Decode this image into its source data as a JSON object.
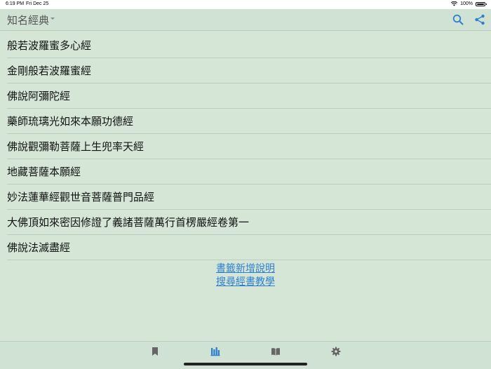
{
  "status_bar": {
    "time": "6:19 PM",
    "date": "Fri Dec 25",
    "battery": "100%"
  },
  "nav": {
    "title": "知名經典"
  },
  "sutras": [
    "般若波羅蜜多心經",
    "金剛般若波羅蜜經",
    "佛說阿彌陀經",
    "藥師琉璃光如來本願功德經",
    "佛說觀彌勒菩薩上生兜率天經",
    "地藏菩薩本願經",
    "妙法蓮華經觀世音菩薩普門品經",
    "大佛頂如來密因修證了義諸菩薩萬行首楞嚴經卷第一",
    "佛說法滅盡經"
  ],
  "links": {
    "bookmark_help": "書籤新增說明",
    "search_tutorial": "搜尋經書教學"
  },
  "tabs": [
    {
      "icon": "bookmark-icon",
      "active": false
    },
    {
      "icon": "library-icon",
      "active": true
    },
    {
      "icon": "book-icon",
      "active": false
    },
    {
      "icon": "gear-icon",
      "active": false
    }
  ],
  "colors": {
    "accent": "#2f7fcf",
    "background": "#d5e6d7",
    "inactive_tab": "#666666"
  }
}
